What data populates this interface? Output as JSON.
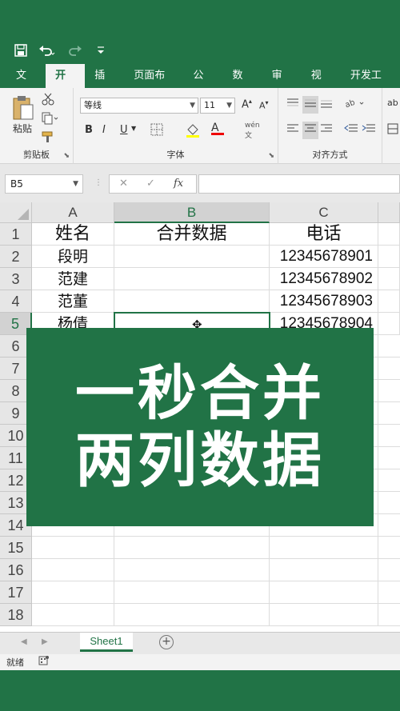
{
  "qat": {
    "save_icon": "save-icon",
    "undo_icon": "undo-icon",
    "redo_icon": "redo-icon",
    "customize_icon": "customize-icon"
  },
  "tabs": [
    {
      "label": "文件"
    },
    {
      "label": "开始"
    },
    {
      "label": "插入"
    },
    {
      "label": "页面布局"
    },
    {
      "label": "公式"
    },
    {
      "label": "数据"
    },
    {
      "label": "审阅"
    },
    {
      "label": "视图"
    },
    {
      "label": "开发工具"
    }
  ],
  "ribbon": {
    "clipboard": {
      "label": "剪贴板",
      "paste_label": "粘贴"
    },
    "font": {
      "label": "字体",
      "font_name": "等线",
      "font_size": "11",
      "bold": "B",
      "italic": "I",
      "underline": "U",
      "grow": "A",
      "shrink": "A",
      "font_color_letter": "A",
      "phonetic": "wén"
    },
    "alignment": {
      "label": "对齐方式"
    }
  },
  "formula_bar": {
    "name_box": "B5",
    "cancel": "✕",
    "enter": "✓",
    "fx": "fx",
    "value": ""
  },
  "grid": {
    "columns": [
      "A",
      "B",
      "C"
    ],
    "selected_column": "B",
    "selected_row": "5",
    "row_numbers": [
      "1",
      "2",
      "3",
      "4",
      "5",
      "6",
      "7",
      "8",
      "9",
      "10",
      "11",
      "12",
      "13",
      "14",
      "15",
      "16",
      "17",
      "18"
    ],
    "header_row": {
      "a": "姓名",
      "b": "合并数据",
      "c": "电话"
    },
    "rows": [
      {
        "a": "段明",
        "b": "",
        "c": "12345678901"
      },
      {
        "a": "范建",
        "b": "",
        "c": "12345678902"
      },
      {
        "a": "范董",
        "b": "",
        "c": "12345678903"
      },
      {
        "a": "杨倩",
        "b": "",
        "c": "12345678904"
      }
    ]
  },
  "overlay": {
    "line1": "一秒合并",
    "line2": "两列数据"
  },
  "sheet_tabs": {
    "active": "Sheet1",
    "add_icon": "add-sheet-icon"
  },
  "status_bar": {
    "ready": "就绪"
  },
  "colors": {
    "brand": "#217346",
    "header_bg": "#e6e6e6",
    "selected_header": "#d2d2d2"
  }
}
